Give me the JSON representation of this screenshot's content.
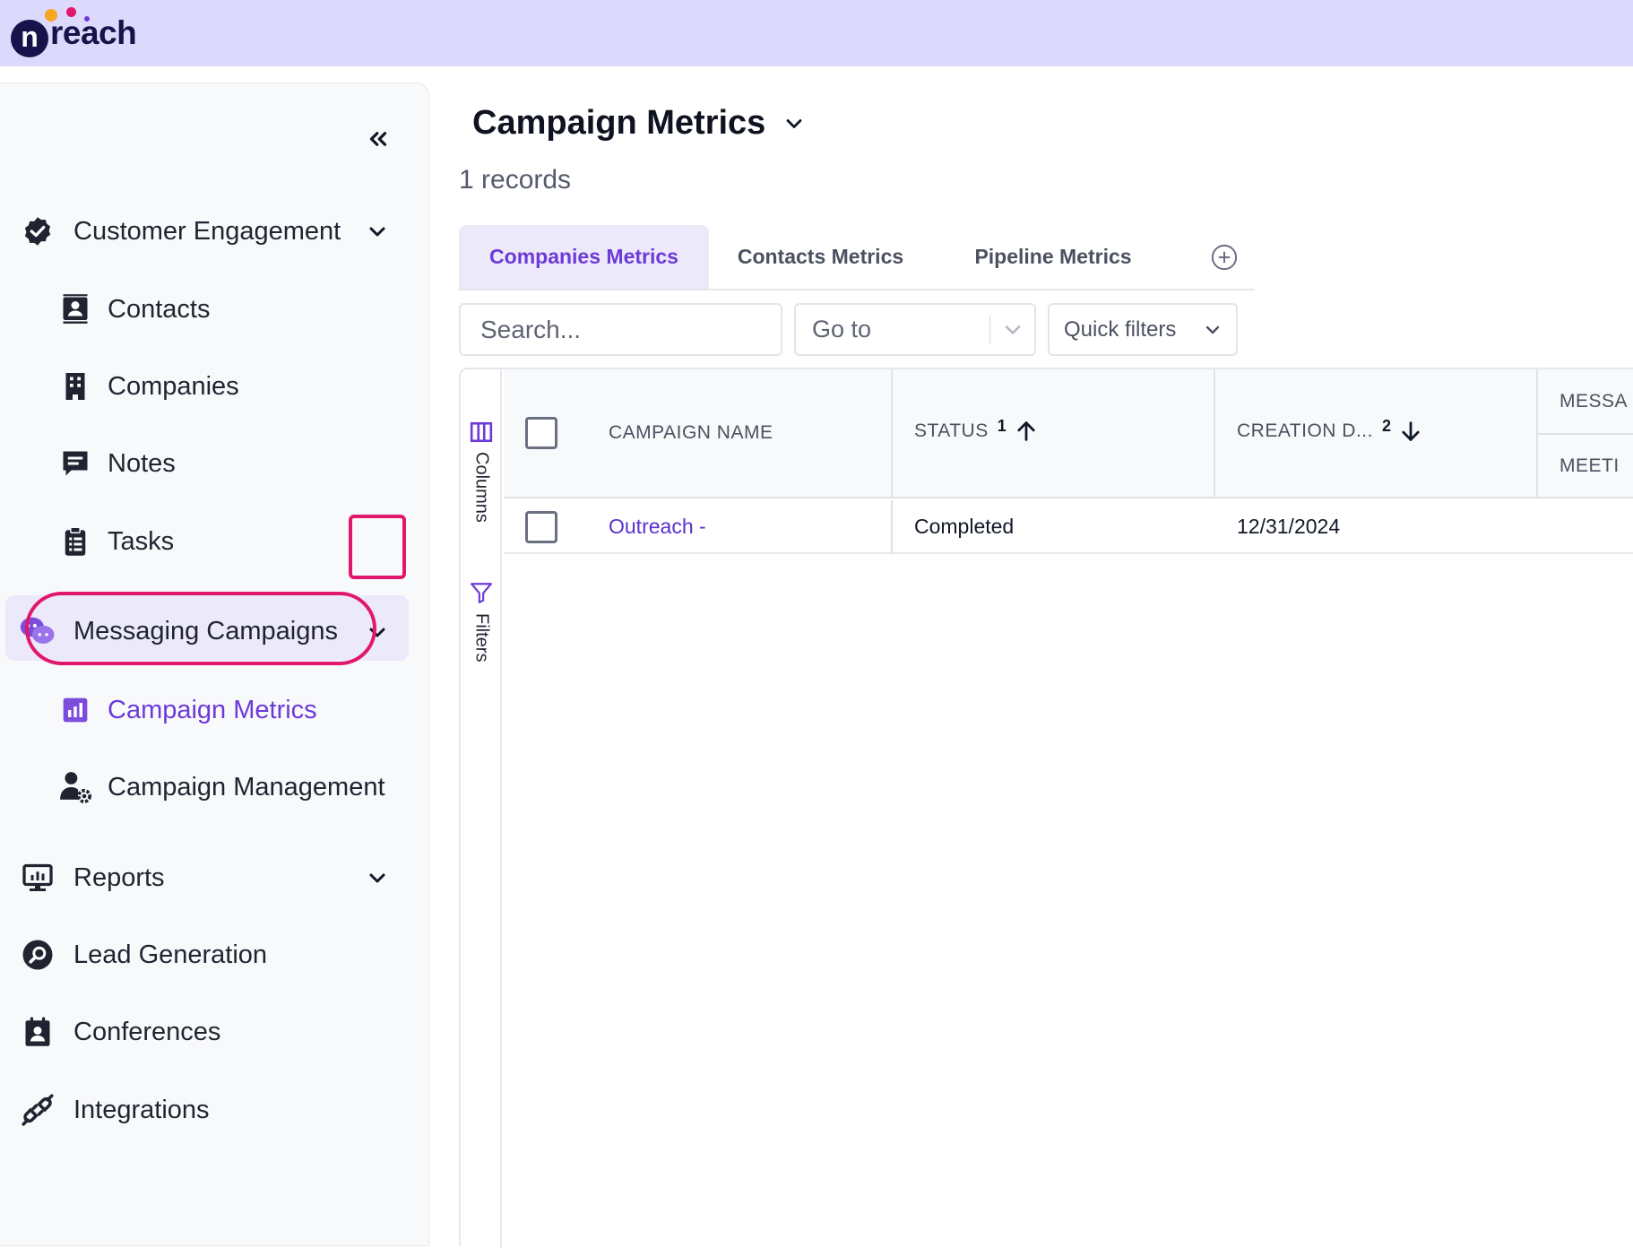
{
  "brand": {
    "logo_text": "reach",
    "logo_letter": "n",
    "colors": {
      "accent": "#6d3ad8",
      "highlight": "#e0176c",
      "topbar": "#ddd9fc"
    }
  },
  "sidebar": {
    "collapse_icon": "double-chevron-left-icon",
    "groups": [
      {
        "label": "Customer Engagement",
        "icon": "verified-badge-icon",
        "expanded": true,
        "items": [
          {
            "label": "Contacts",
            "icon": "contact-card-icon"
          },
          {
            "label": "Companies",
            "icon": "building-icon"
          },
          {
            "label": "Notes",
            "icon": "note-icon"
          },
          {
            "label": "Tasks",
            "icon": "clipboard-icon"
          }
        ]
      },
      {
        "label": "Messaging Campaigns",
        "icon": "chat-bubbles-icon",
        "expanded": true,
        "items": [
          {
            "label": "Campaign Metrics",
            "icon": "bar-chart-icon",
            "active": true
          },
          {
            "label": "Campaign Management",
            "icon": "user-gear-icon"
          }
        ]
      },
      {
        "label": "Reports",
        "icon": "monitor-chart-icon",
        "expanded": false
      },
      {
        "label": "Lead Generation",
        "icon": "search-circle-icon"
      },
      {
        "label": "Conferences",
        "icon": "calendar-user-icon"
      },
      {
        "label": "Integrations",
        "icon": "plug-icon"
      }
    ]
  },
  "main": {
    "title": "Campaign Metrics",
    "records": "1 records",
    "tabs": [
      {
        "label": "Companies Metrics",
        "active": true
      },
      {
        "label": "Contacts Metrics"
      },
      {
        "label": "Pipeline Metrics"
      }
    ],
    "search": {
      "placeholder": "Search..."
    },
    "goto": {
      "placeholder": "Go to"
    },
    "quick_filters": "Quick filters",
    "rail": {
      "columns": "Columns",
      "filters": "Filters"
    },
    "grid": {
      "headers": {
        "campaign_name": "CAMPAIGN NAME",
        "status": "STATUS",
        "status_sort": "1",
        "creation_date": "CREATION D...",
        "creation_sort": "2",
        "messages": "MESSA",
        "meetings": "MEETI"
      },
      "rows": [
        {
          "campaign_name": "Outreach -",
          "status": "Completed",
          "creation_date": "12/31/2024"
        }
      ]
    }
  }
}
